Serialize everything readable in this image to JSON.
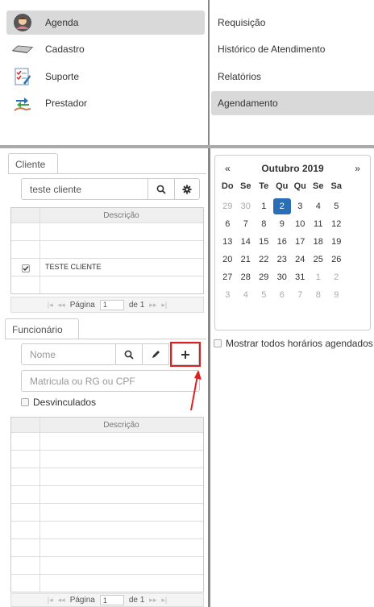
{
  "menu": {
    "items": [
      {
        "label": "Agenda",
        "icon": "agenda-avatar-icon"
      },
      {
        "label": "Cadastro",
        "icon": "keyboard-icon"
      },
      {
        "label": "Suporte",
        "icon": "checklist-icon"
      },
      {
        "label": "Prestador",
        "icon": "provider-exchange-icon"
      }
    ],
    "sub_items": [
      {
        "label": "Requisição"
      },
      {
        "label": "Histórico de Atendimento"
      },
      {
        "label": "Relatórios"
      },
      {
        "label": "Agendamento"
      }
    ]
  },
  "cliente": {
    "tab_label": "Cliente",
    "search_value": "teste cliente",
    "grid_header": "Descrição",
    "rows": [
      {
        "checked": false,
        "text": ""
      },
      {
        "checked": false,
        "text": ""
      },
      {
        "checked": true,
        "text": "TESTE CLIENTE"
      },
      {
        "checked": false,
        "text": ""
      }
    ],
    "pager": {
      "label": "Página",
      "page": "1",
      "of": "de 1"
    }
  },
  "funcionario": {
    "tab_label": "Funcionário",
    "name_placeholder": "Nome",
    "doc_placeholder": "Matricula ou RG ou CPF",
    "desvinculados_label": "Desvinculados",
    "grid_header": "Descrição",
    "pager": {
      "label": "Página",
      "page": "1",
      "of": "de 1"
    }
  },
  "calendar": {
    "prev": "«",
    "next": "»",
    "title": "Outubro 2019",
    "dow": [
      "Do",
      "Se",
      "Te",
      "Qu",
      "Qu",
      "Se",
      "Sa"
    ],
    "weeks": [
      [
        "29",
        "30",
        "1",
        "2",
        "3",
        "4",
        "5"
      ],
      [
        "6",
        "7",
        "8",
        "9",
        "10",
        "11",
        "12"
      ],
      [
        "13",
        "14",
        "15",
        "16",
        "17",
        "18",
        "19"
      ],
      [
        "20",
        "21",
        "22",
        "23",
        "24",
        "25",
        "26"
      ],
      [
        "27",
        "28",
        "29",
        "30",
        "31",
        "1",
        "2"
      ],
      [
        "3",
        "4",
        "5",
        "6",
        "7",
        "8",
        "9"
      ]
    ],
    "muted": [
      [
        0,
        0
      ],
      [
        0,
        1
      ],
      [
        4,
        5
      ],
      [
        4,
        6
      ],
      [
        5,
        0
      ],
      [
        5,
        1
      ],
      [
        5,
        2
      ],
      [
        5,
        3
      ],
      [
        5,
        4
      ],
      [
        5,
        5
      ],
      [
        5,
        6
      ]
    ],
    "selected": [
      0,
      3
    ]
  },
  "schedule_toggle_label": "Mostrar todos horários agendados",
  "colors": {
    "accent": "#2a6fb6",
    "highlight": "#e02020"
  }
}
